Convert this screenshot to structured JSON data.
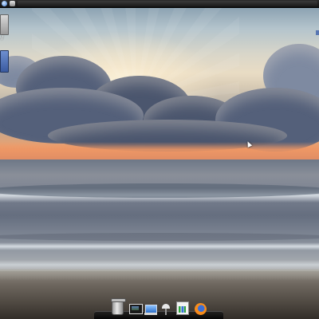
{
  "topbar": {
    "icons": [
      "globe-icon",
      "window-icon"
    ]
  },
  "desktop": {
    "wallpaper": "beach-sunset",
    "icons": [
      {
        "name": "drive-icon",
        "label": "·/"
      },
      {
        "name": "folder-icon",
        "label": ""
      }
    ]
  },
  "dock": {
    "items": [
      {
        "name": "trash-icon"
      },
      {
        "name": "photo-viewer-icon"
      },
      {
        "name": "computer-icon"
      },
      {
        "name": "lamp-icon"
      },
      {
        "name": "chart-icon"
      },
      {
        "name": "firefox-icon"
      }
    ]
  },
  "colors": {
    "topbar": "#1b1b1b",
    "sky_horizon": "#e9a171",
    "clouds": "#54607a",
    "sea": "#7b8291",
    "sand": "#4c463f"
  }
}
